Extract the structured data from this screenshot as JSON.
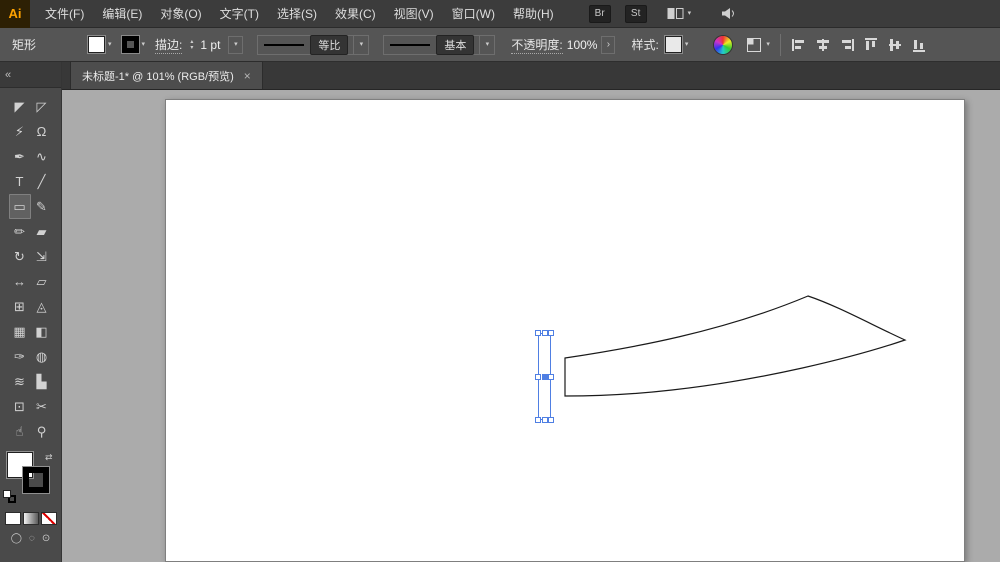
{
  "colors": {
    "accent": "#4f7fe3",
    "logo": "#ffa200",
    "artboard": "#ffffff",
    "fill_swatch": "#ffffff",
    "stroke_swatch": "#000000"
  },
  "icons": {
    "caret": "▾",
    "stepper_up": "▴",
    "stepper_down": "▾",
    "expand": "›",
    "swap": "⇄",
    "close": "×",
    "collapse": "«"
  },
  "menubar": {
    "logo": "Ai",
    "items": [
      "文件(F)",
      "编辑(E)",
      "对象(O)",
      "文字(T)",
      "选择(S)",
      "效果(C)",
      "视图(V)",
      "窗口(W)",
      "帮助(H)"
    ],
    "badges": [
      "Br",
      "St"
    ]
  },
  "controlbar": {
    "tool_label": "矩形",
    "stroke_label": "描边:",
    "stroke_weight": "1 pt",
    "profile_label": "等比",
    "brush_label": "基本",
    "opacity_label": "不透明度:",
    "opacity_value": "100%",
    "style_label": "样式:"
  },
  "tabbar": {
    "document_title": "未标题-1* @ 101% (RGB/预览)"
  },
  "toolbar": {
    "tools": [
      {
        "id": "selection-tool",
        "glyph": "◤"
      },
      {
        "id": "direct-selection-tool",
        "glyph": "◸"
      },
      {
        "id": "magic-wand-tool",
        "glyph": "⚡"
      },
      {
        "id": "lasso-tool",
        "glyph": "Ω"
      },
      {
        "id": "pen-tool",
        "glyph": "✒"
      },
      {
        "id": "curvature-tool",
        "glyph": "∿"
      },
      {
        "id": "type-tool",
        "glyph": "T"
      },
      {
        "id": "line-segment-tool",
        "glyph": "╱"
      },
      {
        "id": "rectangle-tool",
        "glyph": "▭"
      },
      {
        "id": "paintbrush-tool",
        "glyph": "✎"
      },
      {
        "id": "pencil-tool",
        "glyph": "✏"
      },
      {
        "id": "eraser-tool",
        "glyph": "▰"
      },
      {
        "id": "rotate-tool",
        "glyph": "↻"
      },
      {
        "id": "scale-tool",
        "glyph": "⇲"
      },
      {
        "id": "width-tool",
        "glyph": "↔"
      },
      {
        "id": "free-transform-tool",
        "glyph": "▱"
      },
      {
        "id": "shape-builder-tool",
        "glyph": "⊞"
      },
      {
        "id": "perspective-grid-tool",
        "glyph": "◬"
      },
      {
        "id": "mesh-tool",
        "glyph": "▦"
      },
      {
        "id": "gradient-tool",
        "glyph": "◧"
      },
      {
        "id": "eyedropper-tool",
        "glyph": "✑"
      },
      {
        "id": "blend-tool",
        "glyph": "◍"
      },
      {
        "id": "symbol-sprayer-tool",
        "glyph": "≋"
      },
      {
        "id": "column-graph-tool",
        "glyph": "▙"
      },
      {
        "id": "artboard-tool",
        "glyph": "⊡"
      },
      {
        "id": "slice-tool",
        "glyph": "✂"
      },
      {
        "id": "hand-tool",
        "glyph": "☝"
      },
      {
        "id": "zoom-tool",
        "glyph": "⚲"
      }
    ],
    "modes": [
      "◯",
      "◌",
      "⊙"
    ]
  }
}
